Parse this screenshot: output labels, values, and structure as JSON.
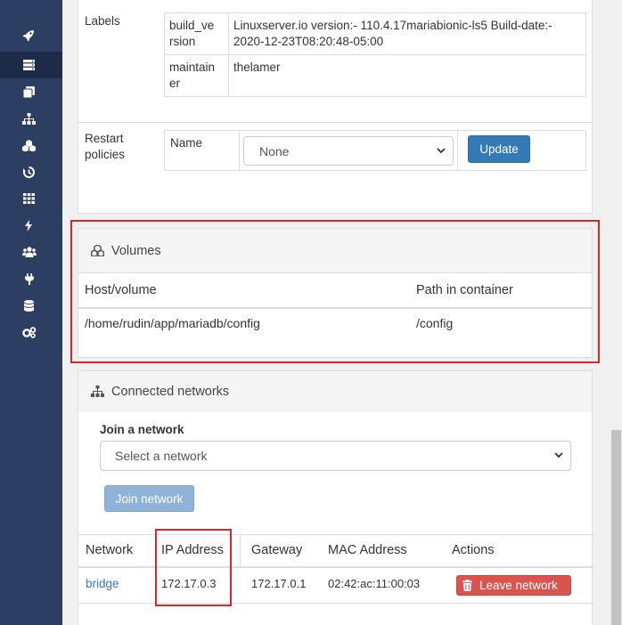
{
  "sidebar": {
    "icons": [
      "rocket-icon",
      "list-icon",
      "server-icon",
      "clone-icon",
      "sitemap-icon",
      "cubes-icon",
      "history-icon",
      "grid-icon",
      "bolt-icon",
      "users-icon",
      "plug-icon",
      "database-icon",
      "cogs-icon"
    ],
    "active_index": 2
  },
  "details": {
    "labels_title": "Labels",
    "labels": [
      {
        "key": "build_version",
        "key_display_1": "build_ve",
        "key_display_2": "rsion",
        "value_1": "Linuxserver.io version:- 110.4.17mariabionic-ls5 Build-date:-",
        "value_2": "2020-12-23T08:20:48-05:00"
      },
      {
        "key": "maintainer",
        "key_display_1": "maintain",
        "key_display_2": "er",
        "value_1": "thelamer"
      }
    ],
    "restart_title_1": "Restart",
    "restart_title_2": "policies",
    "restart_name_label": "Name",
    "restart_selected": "None",
    "update_label": "Update"
  },
  "volumes": {
    "title": "Volumes",
    "col_host": "Host/volume",
    "col_path": "Path in container",
    "rows": [
      {
        "host": "/home/rudin/app/mariadb/config",
        "path": "/config"
      }
    ]
  },
  "networks": {
    "title": "Connected networks",
    "join_label": "Join a network",
    "select_placeholder": "Select a network",
    "join_button": "Join network",
    "columns": [
      "Network",
      "IP Address",
      "Gateway",
      "MAC Address",
      "Actions"
    ],
    "rows": [
      {
        "network": "bridge",
        "ip": "172.17.0.3",
        "gateway": "172.17.0.1",
        "mac": "02:42:ac:11:00:03",
        "action": "Leave network"
      }
    ]
  },
  "colors": {
    "sidebar": "#2d3e63",
    "primary": "#337ab7",
    "danger": "#d9534f",
    "highlight": "#d9262c"
  }
}
